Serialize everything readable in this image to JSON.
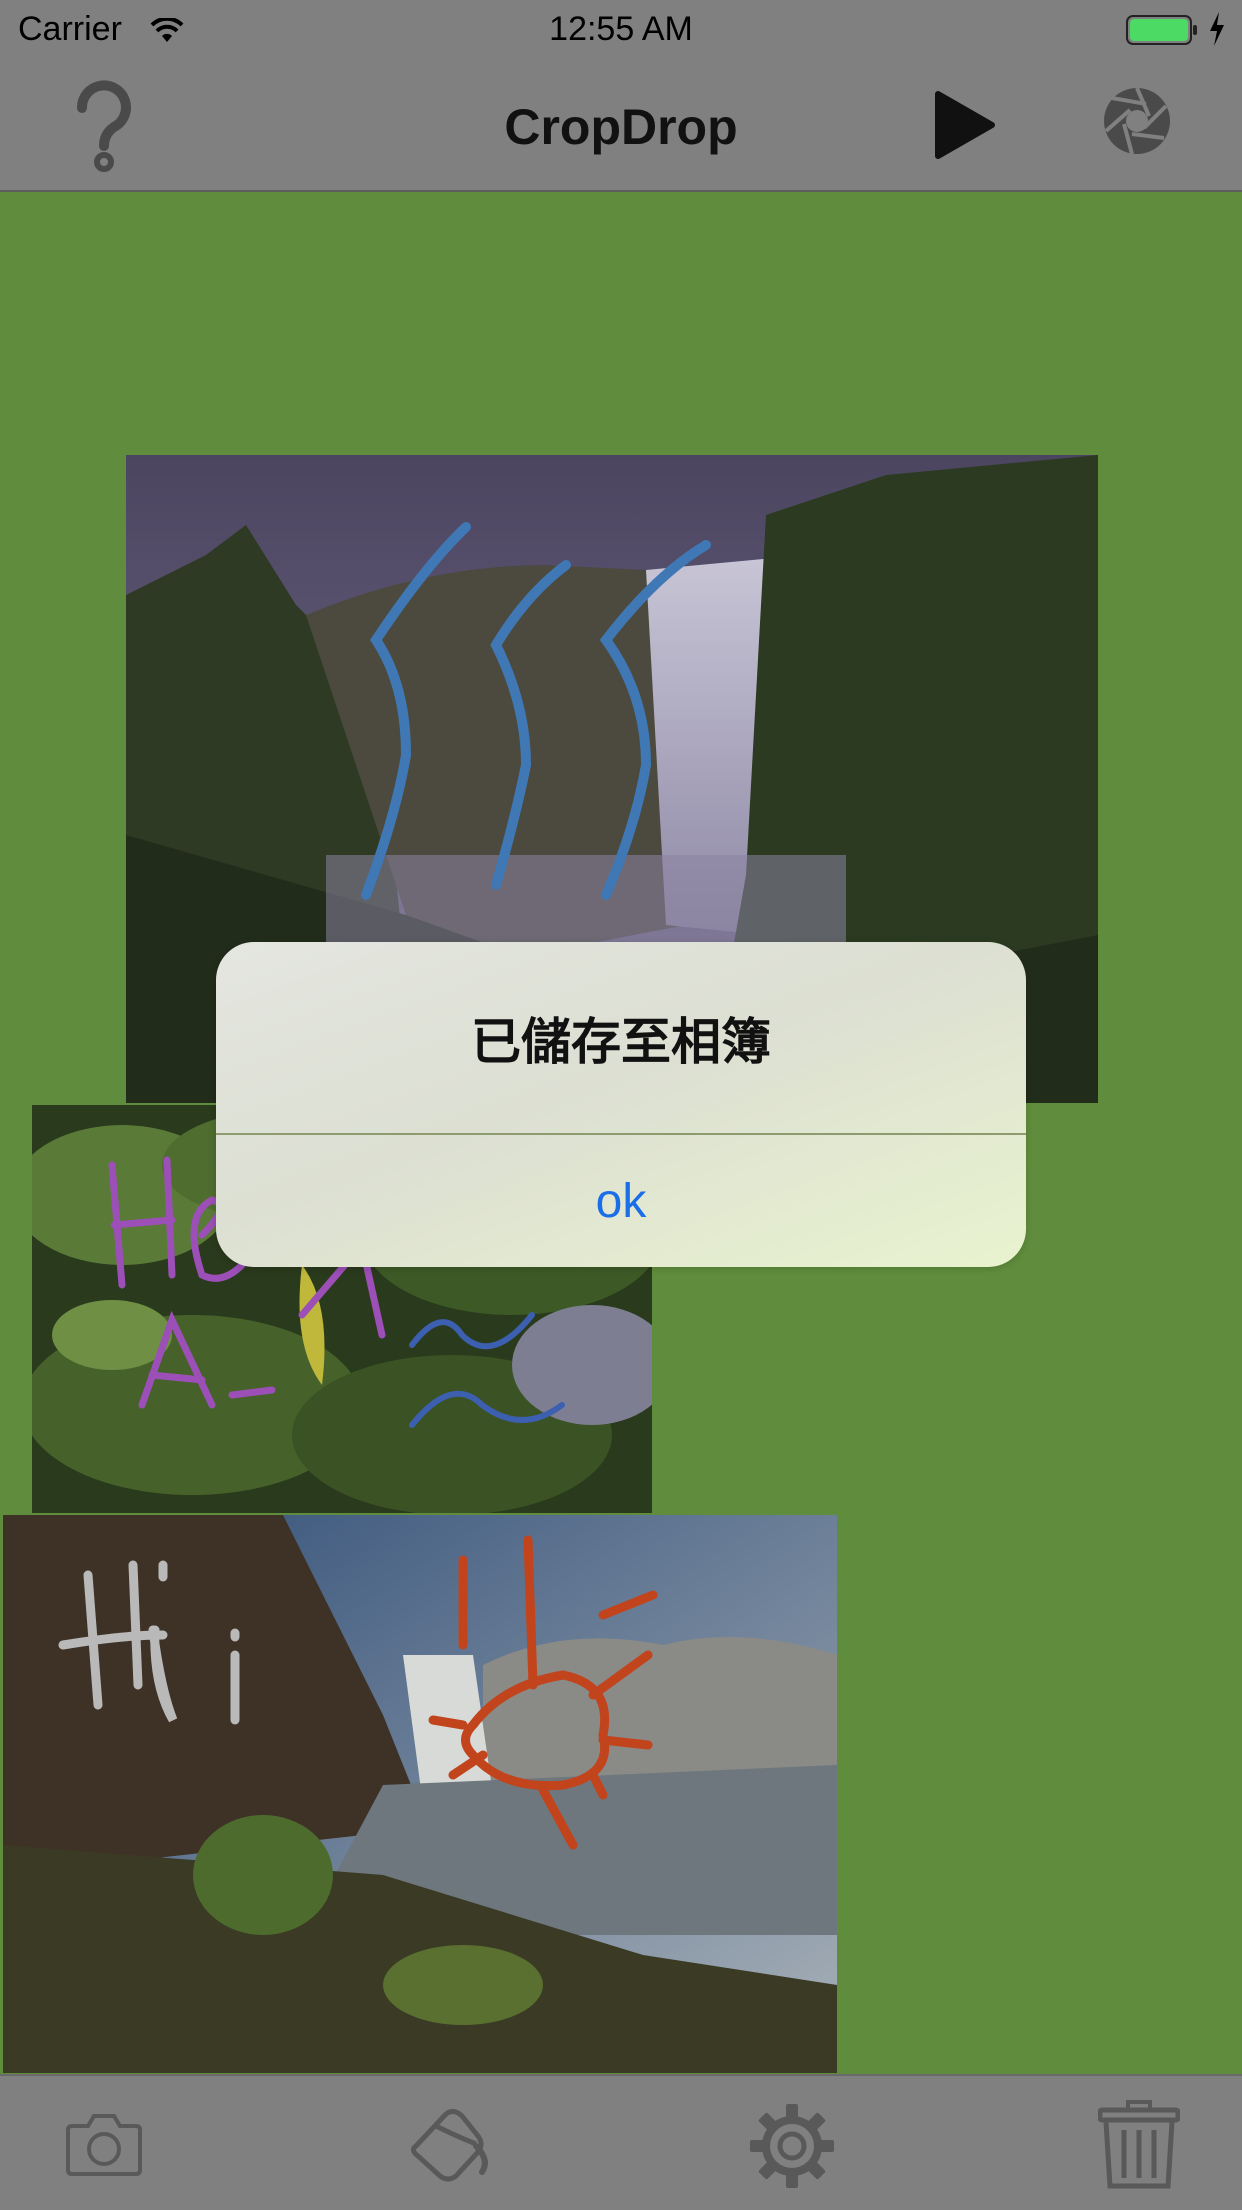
{
  "status_bar": {
    "carrier": "Carrier",
    "time": "12:55 AM",
    "battery_color": "#4cd964"
  },
  "nav_bar": {
    "title": "CropDrop",
    "left_icon": "help-icon",
    "right_icons": [
      "play-icon",
      "camera-shutter-icon"
    ]
  },
  "canvas": {
    "background": "#608d3d",
    "photos": [
      {
        "name": "waterfall-photo-1",
        "doodle": "blue-wavy-lines"
      },
      {
        "name": "plant-photo",
        "doodle": "purple-text-and-blue-waves"
      },
      {
        "name": "waterfall-photo-2",
        "doodle": "Hi-and-sun"
      }
    ]
  },
  "alert": {
    "title": "已儲存至相簿",
    "button_label": "ok",
    "button_color": "#1a6ee8"
  },
  "tab_bar": {
    "icons": [
      "camera-icon",
      "paint-bucket-icon",
      "settings-gear-icon",
      "trash-icon"
    ]
  }
}
